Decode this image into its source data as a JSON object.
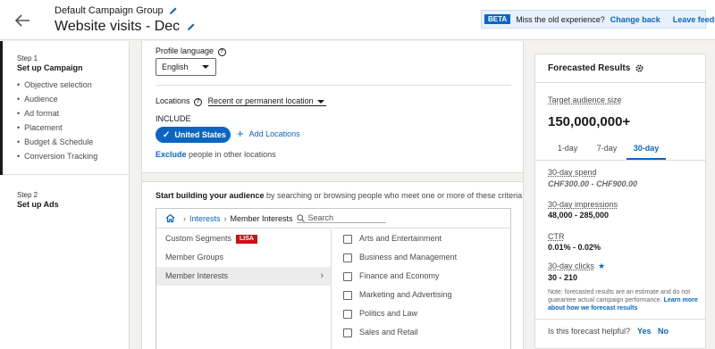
{
  "header": {
    "group_name": "Default Campaign Group",
    "campaign_name": "Website visits - Dec",
    "beta_badge": "BETA",
    "beta_message": "Miss the old experience?",
    "change_back": "Change back",
    "leave_feedback": "Leave feedback"
  },
  "sidebar": {
    "step1_num": "Step 1",
    "step1_title": "Set up Campaign",
    "items": [
      "Objective selection",
      "Audience",
      "Ad format",
      "Placement",
      "Budget & Schedule",
      "Conversion Tracking"
    ],
    "step2_num": "Step 2",
    "step2_title": "Set up Ads"
  },
  "main": {
    "profile_language_label": "Profile language",
    "language_value": "English",
    "locations_label": "Locations",
    "location_type": "Recent or permanent location",
    "include_label": "INCLUDE",
    "selected_location": "United States",
    "add_locations": "Add Locations",
    "exclude_link": "Exclude",
    "exclude_text": "people in other locations",
    "build_bold": "Start building your audience",
    "build_rest": "by searching or browsing people who meet one or more of these criteria",
    "crumb_interests": "Interests",
    "crumb_member_interests": "Member Interests",
    "search_placeholder": "Search",
    "left_items": [
      {
        "label": "Custom Segments",
        "badge": "LISA"
      },
      {
        "label": "Member Groups"
      },
      {
        "label": "Member Interests",
        "chevron": "›"
      }
    ],
    "right_items": [
      "Arts and Entertainment",
      "Business and Management",
      "Finance and Economy",
      "Marketing and Advertising",
      "Politics and Law",
      "Sales and Retail"
    ]
  },
  "forecast": {
    "title": "Forecasted Results",
    "target_label": "Target audience size",
    "target_value": "150,000,000+",
    "tabs": [
      "1-day",
      "7-day",
      "30-day"
    ],
    "active_tab": "30-day",
    "spend_label": "30-day spend",
    "spend_value": "CHF300.00 - CHF900.00",
    "impressions_label": "30-day impressions",
    "impressions_value": "48,000 - 285,000",
    "ctr_label": "CTR",
    "ctr_value": "0.01% - 0.02%",
    "clicks_label": "30-day clicks",
    "clicks_value": "30 - 210",
    "note_text": "Note: forecasted results are an estimate and do not guarantee actual campaign performance.",
    "note_link": "Learn more about how we forecast results",
    "helpful_q": "Is this forecast helpful?",
    "yes": "Yes",
    "no": "No"
  }
}
